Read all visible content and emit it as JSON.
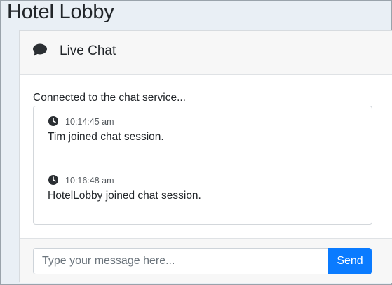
{
  "page": {
    "title": "Hotel Lobby"
  },
  "chat": {
    "header_icon": "comment-icon",
    "header_title": "Live Chat",
    "status": "Connected to the chat service...",
    "messages": [
      {
        "icon": "clock-icon",
        "time": "10:14:45 am",
        "text": "Tim joined chat session."
      },
      {
        "icon": "clock-icon",
        "time": "10:16:48 am",
        "text": "HotelLobby joined chat session."
      }
    ],
    "input": {
      "placeholder": "Type your message here...",
      "value": ""
    },
    "send_label": "Send"
  },
  "colors": {
    "accent": "#0a7bff",
    "background": "#e9eff5",
    "header": "#f7f7f7"
  }
}
